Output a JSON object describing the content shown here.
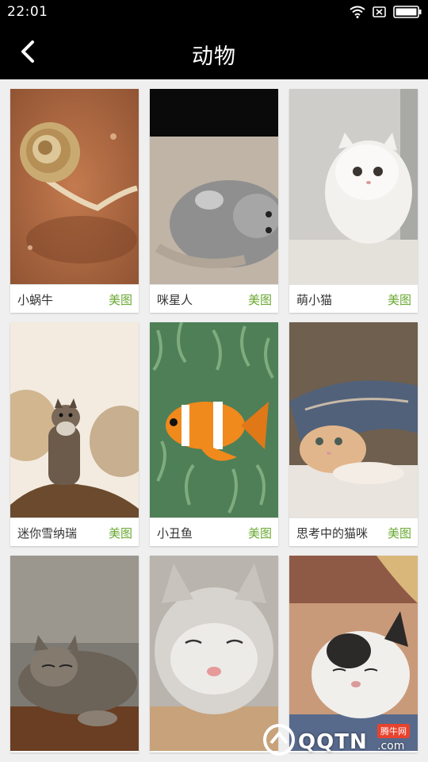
{
  "status_bar": {
    "time": "22:01"
  },
  "header": {
    "title": "动物"
  },
  "items": [
    {
      "name": "小蜗牛",
      "tag": "美图"
    },
    {
      "name": "咪星人",
      "tag": "美图"
    },
    {
      "name": "萌小猫",
      "tag": "美图"
    },
    {
      "name": "迷你雪纳瑞",
      "tag": "美图"
    },
    {
      "name": "小丑鱼",
      "tag": "美图"
    },
    {
      "name": "思考中的猫咪",
      "tag": "美图"
    },
    {
      "name": "",
      "tag": ""
    },
    {
      "name": "",
      "tag": ""
    },
    {
      "name": "",
      "tag": ""
    }
  ],
  "watermark": {
    "text": "QQTN",
    "suffix": ".com",
    "badge": "腾牛网"
  },
  "colors": {
    "accent": "#6aa832",
    "header_bg": "#000000"
  }
}
